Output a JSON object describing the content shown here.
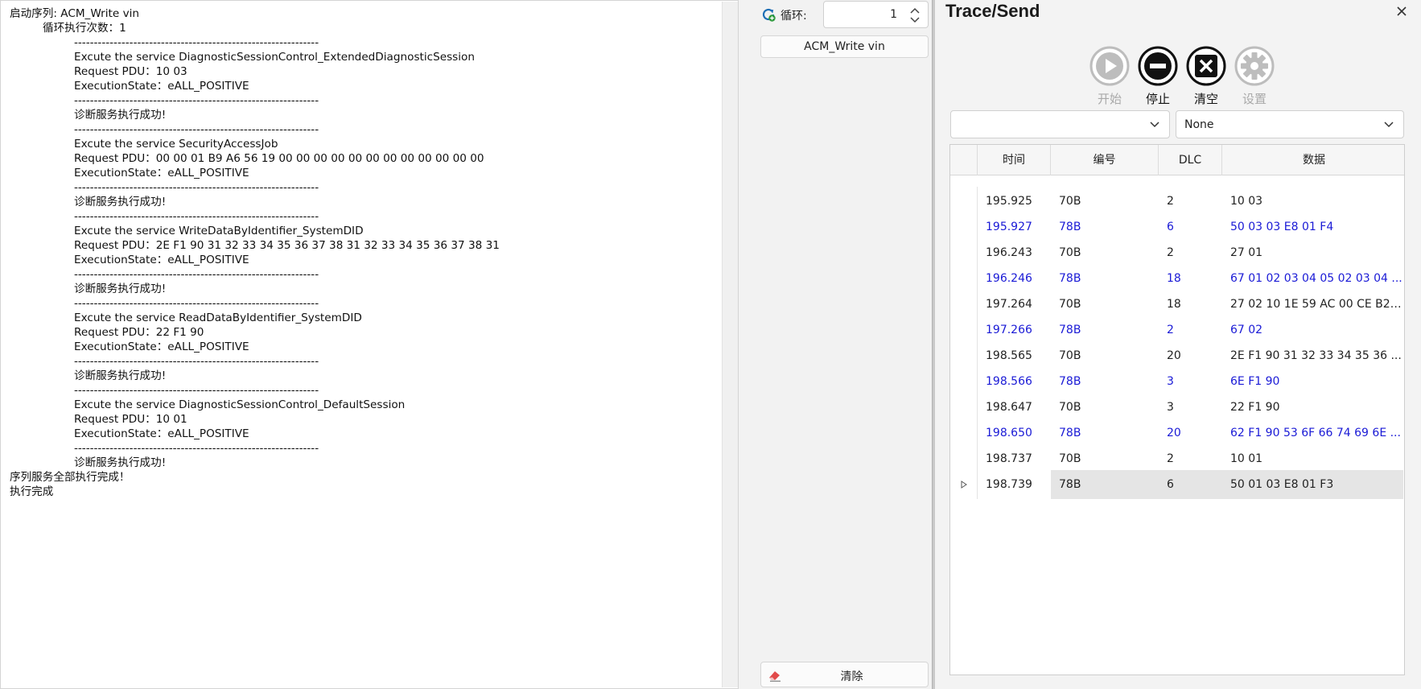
{
  "log": {
    "lines": [
      {
        "indent": 0,
        "text": "启动序列: ACM_Write vin"
      },
      {
        "indent": 1,
        "text": "循环执行次数：1"
      },
      {
        "indent": 2,
        "text": "--------------------------------------------------------------"
      },
      {
        "indent": 2,
        "text": "Excute the service DiagnosticSessionControl_ExtendedDiagnosticSession"
      },
      {
        "indent": 2,
        "text": "Request PDU：10 03"
      },
      {
        "indent": 2,
        "text": "ExecutionState：eALL_POSITIVE"
      },
      {
        "indent": 2,
        "text": "--------------------------------------------------------------"
      },
      {
        "indent": 2,
        "text": "诊断服务执行成功!"
      },
      {
        "indent": 2,
        "text": "--------------------------------------------------------------"
      },
      {
        "indent": 2,
        "text": "Excute the service SecurityAccessJob"
      },
      {
        "indent": 2,
        "text": "Request PDU：00 00 01 B9 A6 56 19 00 00 00 00 00 00 00 00 00 00 00 00"
      },
      {
        "indent": 2,
        "text": "ExecutionState：eALL_POSITIVE"
      },
      {
        "indent": 2,
        "text": "--------------------------------------------------------------"
      },
      {
        "indent": 2,
        "text": "诊断服务执行成功!"
      },
      {
        "indent": 2,
        "text": "--------------------------------------------------------------"
      },
      {
        "indent": 2,
        "text": "Excute the service WriteDataByIdentifier_SystemDID"
      },
      {
        "indent": 2,
        "text": "Request PDU：2E F1 90 31 32 33 34 35 36 37 38 31 32 33 34 35 36 37 38 31"
      },
      {
        "indent": 2,
        "text": "ExecutionState：eALL_POSITIVE"
      },
      {
        "indent": 2,
        "text": "--------------------------------------------------------------"
      },
      {
        "indent": 2,
        "text": "诊断服务执行成功!"
      },
      {
        "indent": 2,
        "text": "--------------------------------------------------------------"
      },
      {
        "indent": 2,
        "text": "Excute the service ReadDataByIdentifier_SystemDID"
      },
      {
        "indent": 2,
        "text": "Request PDU：22 F1 90"
      },
      {
        "indent": 2,
        "text": "ExecutionState：eALL_POSITIVE"
      },
      {
        "indent": 2,
        "text": "--------------------------------------------------------------"
      },
      {
        "indent": 2,
        "text": "诊断服务执行成功!"
      },
      {
        "indent": 2,
        "text": "--------------------------------------------------------------"
      },
      {
        "indent": 2,
        "text": "Excute the service DiagnosticSessionControl_DefaultSession"
      },
      {
        "indent": 2,
        "text": "Request PDU：10 01"
      },
      {
        "indent": 2,
        "text": "ExecutionState：eALL_POSITIVE"
      },
      {
        "indent": 2,
        "text": "--------------------------------------------------------------"
      },
      {
        "indent": 2,
        "text": "诊断服务执行成功!"
      },
      {
        "indent": 0,
        "text": "序列服务全部执行完成！"
      },
      {
        "indent": 0,
        "text": "执行完成"
      }
    ]
  },
  "middle": {
    "loop_label": "循环:",
    "loop_value": "1",
    "sequence_button": "ACM_Write vin",
    "clear_button": "清除",
    "loop_icon": "refresh-icon",
    "clear_icon": "eraser-icon"
  },
  "trace": {
    "title": "Trace/Send",
    "close_icon": "close-icon",
    "toolbar": {
      "start": {
        "label": "开始",
        "icon": "play-icon",
        "enabled": false
      },
      "stop": {
        "label": "停止",
        "icon": "stop-icon",
        "enabled": true
      },
      "clear": {
        "label": "清空",
        "icon": "clear-icon",
        "enabled": true
      },
      "settings": {
        "label": "设置",
        "icon": "gear-icon",
        "enabled": false
      }
    },
    "filter_left_value": "",
    "filter_right_value": "None",
    "columns": [
      "时间",
      "编号",
      "DLC",
      "数据"
    ],
    "rows": [
      {
        "time": "195.925",
        "id": "70B",
        "dlc": "2",
        "data": "10 03",
        "dir": "tx"
      },
      {
        "time": "195.927",
        "id": "78B",
        "dlc": "6",
        "data": "50 03 03 E8 01 F4",
        "dir": "rx"
      },
      {
        "time": "196.243",
        "id": "70B",
        "dlc": "2",
        "data": "27 01",
        "dir": "tx"
      },
      {
        "time": "196.246",
        "id": "78B",
        "dlc": "18",
        "data": "67 01 02 03 04 05 02 03 04 ...",
        "dir": "rx"
      },
      {
        "time": "197.264",
        "id": "70B",
        "dlc": "18",
        "data": "27 02 10 1E 59 AC 00 CE B2 ...",
        "dir": "tx"
      },
      {
        "time": "197.266",
        "id": "78B",
        "dlc": "2",
        "data": "67 02",
        "dir": "rx"
      },
      {
        "time": "198.565",
        "id": "70B",
        "dlc": "20",
        "data": "2E F1 90 31 32 33 34 35 36 ...",
        "dir": "tx"
      },
      {
        "time": "198.566",
        "id": "78B",
        "dlc": "3",
        "data": "6E F1 90",
        "dir": "rx"
      },
      {
        "time": "198.647",
        "id": "70B",
        "dlc": "3",
        "data": "22 F1 90",
        "dir": "tx"
      },
      {
        "time": "198.650",
        "id": "78B",
        "dlc": "20",
        "data": "62 F1 90 53 6F 66 74 69 6E ...",
        "dir": "rx"
      },
      {
        "time": "198.737",
        "id": "70B",
        "dlc": "2",
        "data": "10 01",
        "dir": "tx"
      },
      {
        "time": "198.739",
        "id": "78B",
        "dlc": "6",
        "data": "50 01 03 E8 01 F3",
        "dir": "tx",
        "selected": true
      }
    ],
    "colors": {
      "tx": "#222222",
      "rx": "#1a1ad6",
      "selected_bg": "#e5e5e5"
    }
  }
}
